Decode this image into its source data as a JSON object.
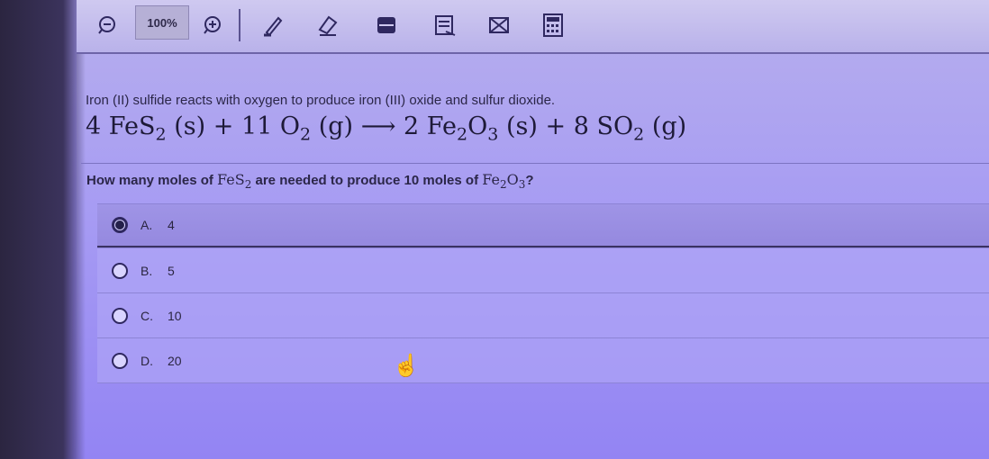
{
  "toolbar": {
    "zoom_out_icon": "zoom-out-icon",
    "zoom_level": "100%",
    "zoom_in_icon": "zoom-in-icon",
    "icons": [
      "pencil-icon",
      "eraser-icon",
      "highlight-icon",
      "notes-icon",
      "delete-icon",
      "calculator-icon"
    ]
  },
  "question": {
    "intro": "Iron (II) sulfide reacts with oxygen to produce iron (III) oxide and sulfur dioxide.",
    "equation": {
      "c1": "4",
      "r1": "FeS",
      "r1_sub": "2",
      "r1_state": "(s)",
      "plus1": "+",
      "c2": "11",
      "r2": "O",
      "r2_sub": "2",
      "r2_state": "(g)",
      "arrow": "⟶",
      "c3": "2",
      "p1a": "Fe",
      "p1a_sub": "2",
      "p1b": "O",
      "p1b_sub": "3",
      "p1_state": "(s)",
      "plus2": "+",
      "c4": "8",
      "p2": "SO",
      "p2_sub": "2",
      "p2_state": "(g)"
    },
    "prompt_part1": "How many moles of",
    "prompt_chem1": "FeS",
    "prompt_chem1_sub": "2",
    "prompt_part2": "are needed to produce 10 moles of",
    "prompt_chem2a": "Fe",
    "prompt_chem2a_sub": "2",
    "prompt_chem2b": "O",
    "prompt_chem2b_sub": "3",
    "prompt_end": "?"
  },
  "options": [
    {
      "letter": "A.",
      "value": "4",
      "selected": true
    },
    {
      "letter": "B.",
      "value": "5",
      "selected": false
    },
    {
      "letter": "C.",
      "value": "10",
      "selected": false
    },
    {
      "letter": "D.",
      "value": "20",
      "selected": false
    }
  ]
}
